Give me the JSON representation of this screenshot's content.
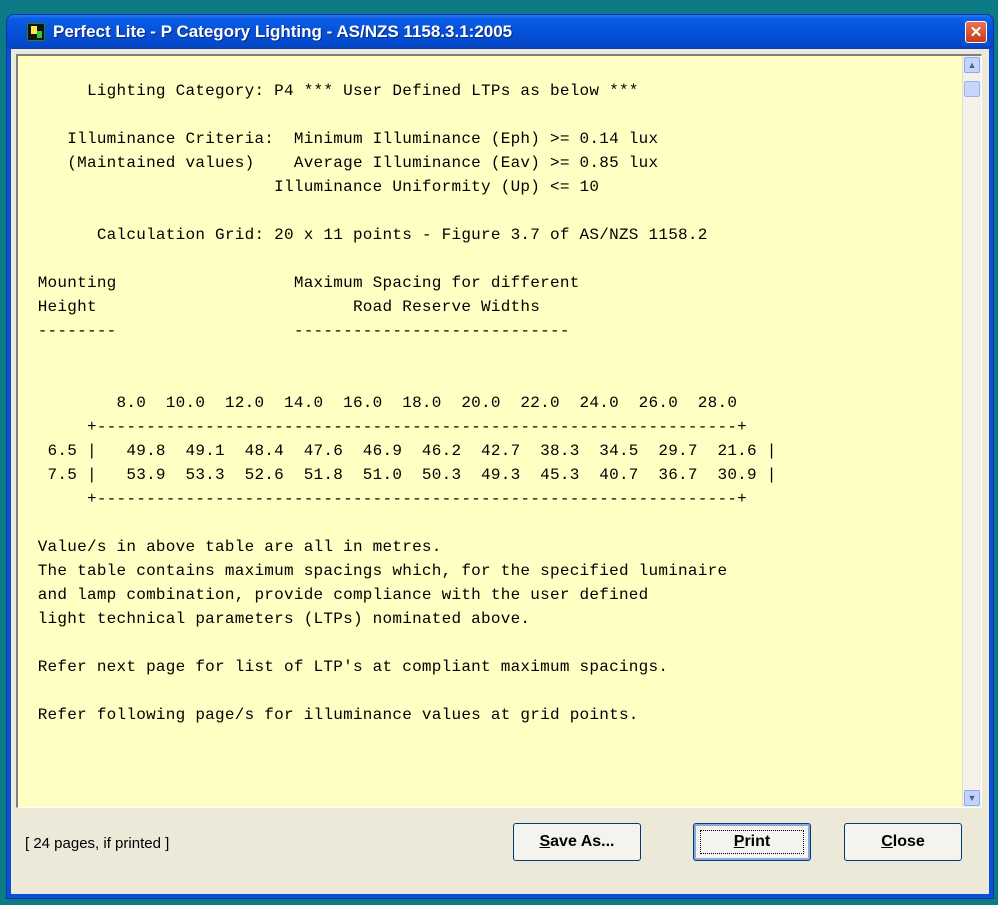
{
  "window": {
    "title": "Perfect Lite - P Category Lighting - AS/NZS 1158.3.1:2005",
    "icons": {
      "app": "perfect-lite-app-icon",
      "close": "close-x-icon"
    },
    "close_glyph": "✕"
  },
  "report": {
    "lines": [
      "       Lighting Category: P4 *** User Defined LTPs as below ***",
      "",
      "     Illuminance Criteria:  Minimum Illuminance (Eph) >= 0.14 lux",
      "     (Maintained values)    Average Illuminance (Eav) >= 0.85 lux",
      "                          Illuminance Uniformity (Up) <= 10",
      "",
      "        Calculation Grid: 20 x 11 points - Figure 3.7 of AS/NZS 1158.2",
      "",
      "  Mounting                  Maximum Spacing for different",
      "  Height                          Road Reserve Widths",
      "  --------                  ----------------------------",
      "",
      "",
      "          8.0  10.0  12.0  14.0  16.0  18.0  20.0  22.0  24.0  26.0  28.0",
      "       +-----------------------------------------------------------------+",
      "   6.5 |   49.8  49.1  48.4  47.6  46.9  46.2  42.7  38.3  34.5  29.7  21.6 |",
      "   7.5 |   53.9  53.3  52.6  51.8  51.0  50.3  49.3  45.3  40.7  36.7  30.9 |",
      "       +-----------------------------------------------------------------+",
      "",
      "  Value/s in above table are all in metres.",
      "  The table contains maximum spacings which, for the specified luminaire",
      "  and lamp combination, provide compliance with the user defined",
      "  light technical parameters (LTPs) nominated above.",
      "",
      "  Refer next page for list of LTP's at compliant maximum spacings.",
      "",
      "  Refer following page/s for illuminance values at grid points.",
      "",
      "",
      "",
      "-----------------------------------------------------------------------------"
    ],
    "scroll_icons": {
      "up": "scroll-up-arrow-icon",
      "down": "scroll-down-arrow-icon"
    },
    "scroll_glyphs": {
      "up": "▲",
      "down": "▼"
    }
  },
  "footer": {
    "status": "[ 24 pages, if printed ]",
    "buttons": {
      "save_as": {
        "mnemonic": "S",
        "rest": "ave As..."
      },
      "print": {
        "mnemonic": "P",
        "rest": "rint"
      },
      "close": {
        "mnemonic": "C",
        "rest": "lose"
      }
    }
  },
  "colors": {
    "desktop": "#0c7a86",
    "titlebar": "#0550d8",
    "report_background": "#ffffc4",
    "dialog_face": "#ece9d8",
    "close_button": "#d9472a"
  }
}
